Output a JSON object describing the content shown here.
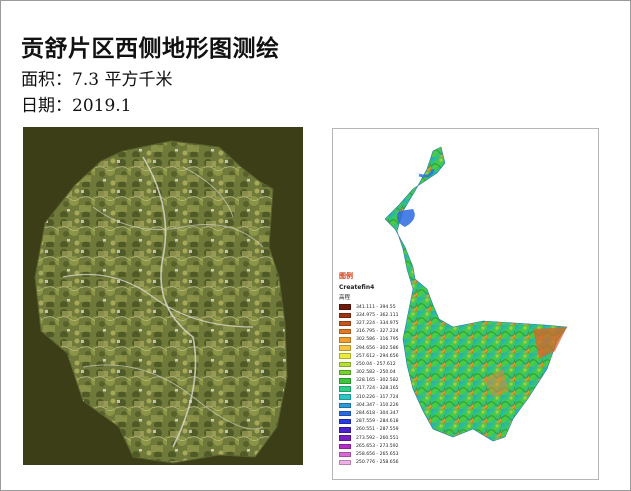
{
  "title": "贡舒片区西侧地形图测绘",
  "area_line": "面积：7.3 平方千米",
  "date_line": "日期：2019.1",
  "legend": {
    "header": "图例",
    "layer": "Createfin4",
    "field": "高程",
    "classes": [
      {
        "range": "341.111 - 394.55",
        "color": "#6e1a0a"
      },
      {
        "range": "334.975 - 362.111",
        "color": "#9a3512"
      },
      {
        "range": "327.224 - 334.975",
        "color": "#c2561c"
      },
      {
        "range": "316.795 - 327.224",
        "color": "#e07a24"
      },
      {
        "range": "302.586 - 316.795",
        "color": "#f0a030"
      },
      {
        "range": "294.656 - 302.586",
        "color": "#f6c640"
      },
      {
        "range": "257.612 - 294.656",
        "color": "#eaea3a"
      },
      {
        "range": "250.04 - 257.612",
        "color": "#b6e034"
      },
      {
        "range": "302.582 - 250.04",
        "color": "#72d22e"
      },
      {
        "range": "328.165 - 302.582",
        "color": "#3cc43a"
      },
      {
        "range": "317.724 - 328.165",
        "color": "#2cd08a"
      },
      {
        "range": "310.226 - 317.724",
        "color": "#2ac8c4"
      },
      {
        "range": "304.347 - 310.226",
        "color": "#2a9ad8"
      },
      {
        "range": "284.618 - 304.347",
        "color": "#2a6ae0"
      },
      {
        "range": "287.559 - 284.618",
        "color": "#2a3ade"
      },
      {
        "range": "260.551 - 287.559",
        "color": "#4a22c8"
      },
      {
        "range": "273.592 - 260.551",
        "color": "#7a20c0"
      },
      {
        "range": "265.653 - 273.592",
        "color": "#b42ec8"
      },
      {
        "range": "258.656 - 265.653",
        "color": "#d86ad8"
      },
      {
        "range": "250.776 - 258.656",
        "color": "#f0b0e8"
      }
    ]
  }
}
